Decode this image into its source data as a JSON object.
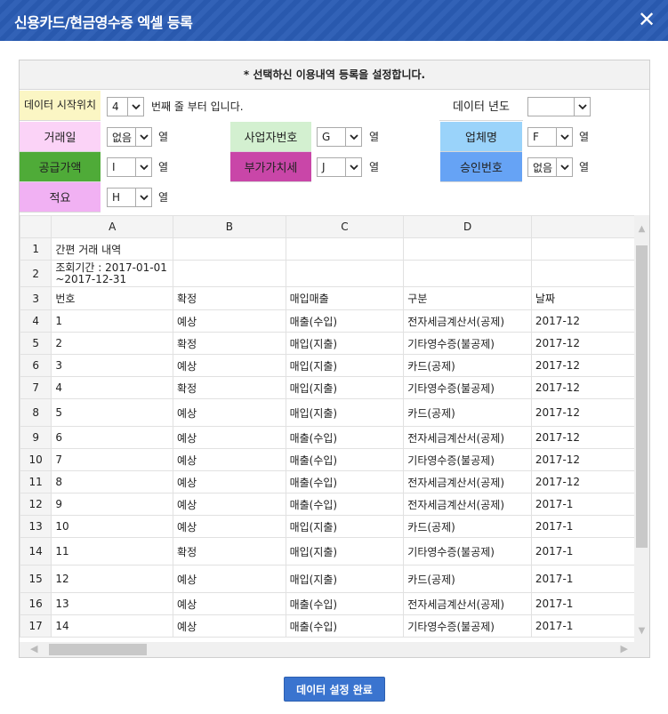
{
  "dialog": {
    "title": "신용카드/현금영수증 엑셀 등록",
    "close_label": "✕"
  },
  "panel": {
    "heading": "* 선택하신 이용내역 등록을 설정합니다."
  },
  "config": {
    "start_row_label": "데이터 시작위치",
    "start_row_value": "4",
    "start_row_suffix": "번째 줄 부터 입니다.",
    "year_label": "데이터 년도",
    "year_value": "",
    "col_unit": "열",
    "fields": [
      {
        "label": "거래일",
        "value": "없음",
        "color": "#fbd3f7"
      },
      {
        "label": "사업자번호",
        "value": "G",
        "color": "#d3f0d0"
      },
      {
        "label": "업체명",
        "value": "F",
        "color": "#9ad3fa"
      },
      {
        "label": "공급가액",
        "value": "I",
        "color": "#4fab38"
      },
      {
        "label": "부가가치세",
        "value": "J",
        "color": "#c946a8"
      },
      {
        "label": "승인번호",
        "value": "없음",
        "color": "#66a3f5"
      },
      {
        "label": "적요",
        "value": "H",
        "color": "#f1b1f3"
      }
    ],
    "start_row_color": "#fbf6c4"
  },
  "grid": {
    "columns": [
      "A",
      "B",
      "C",
      "D",
      ""
    ],
    "rows": [
      {
        "n": "1",
        "cells": [
          "간편 거래 내역",
          "",
          "",
          "",
          ""
        ]
      },
      {
        "n": "2",
        "cells": [
          "조회기간 : 2017-01-01 ~2017-12-31",
          "",
          "",
          "",
          ""
        ]
      },
      {
        "n": "3",
        "cells": [
          "번호",
          "확정",
          "매입매출",
          "구분",
          "날짜"
        ]
      },
      {
        "n": "4",
        "cells": [
          "1",
          "예상",
          "매출(수입)",
          "전자세금계산서(공제)",
          "2017-12"
        ]
      },
      {
        "n": "5",
        "cells": [
          "2",
          "확정",
          "매입(지출)",
          "기타영수증(불공제)",
          "2017-12"
        ]
      },
      {
        "n": "6",
        "cells": [
          "3",
          "예상",
          "매입(지출)",
          "카드(공제)",
          "2017-12"
        ]
      },
      {
        "n": "7",
        "cells": [
          "4",
          "확정",
          "매입(지출)",
          "기타영수증(불공제)",
          "2017-12"
        ]
      },
      {
        "n": "8",
        "cells": [
          "5",
          "예상",
          "매입(지출)",
          "카드(공제)",
          "2017-12"
        ]
      },
      {
        "n": "9",
        "cells": [
          "6",
          "예상",
          "매출(수입)",
          "전자세금계산서(공제)",
          "2017-12"
        ]
      },
      {
        "n": "10",
        "cells": [
          "7",
          "예상",
          "매출(수입)",
          "기타영수증(불공제)",
          "2017-12"
        ]
      },
      {
        "n": "11",
        "cells": [
          "8",
          "예상",
          "매출(수입)",
          "전자세금계산서(공제)",
          "2017-12"
        ]
      },
      {
        "n": "12",
        "cells": [
          "9",
          "예상",
          "매출(수입)",
          "전자세금계산서(공제)",
          "2017-1"
        ]
      },
      {
        "n": "13",
        "cells": [
          "10",
          "예상",
          "매입(지출)",
          "카드(공제)",
          "2017-1"
        ]
      },
      {
        "n": "14",
        "cells": [
          "11",
          "확정",
          "매입(지출)",
          "기타영수증(불공제)",
          "2017-1"
        ]
      },
      {
        "n": "15",
        "cells": [
          "12",
          "예상",
          "매입(지출)",
          "카드(공제)",
          "2017-1"
        ]
      },
      {
        "n": "16",
        "cells": [
          "13",
          "예상",
          "매출(수입)",
          "전자세금계산서(공제)",
          "2017-1"
        ]
      },
      {
        "n": "17",
        "cells": [
          "14",
          "예상",
          "매출(수입)",
          "기타영수증(불공제)",
          "2017-1"
        ]
      }
    ]
  },
  "footer": {
    "done_label": "데이터 설정 완료"
  }
}
